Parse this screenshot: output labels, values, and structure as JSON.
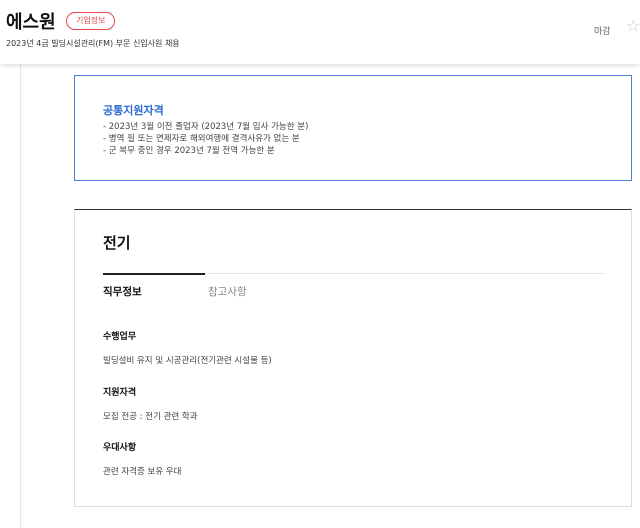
{
  "header": {
    "company": "에스원",
    "badge": "기업정보",
    "subtitle": "2023년 4급 빌딩시설관리(FM) 부문 신입사원 채용",
    "deadline": "마감",
    "star_icon": "star-outline-icon"
  },
  "qualification": {
    "title": "공통지원자격",
    "lines": [
      "- 2023년 3월 이전 졸업자 (2023년 7월 입사 가능한 분)",
      "- 병역 필 또는 면제자로 해외여행에 결격사유가 없는 분",
      "- 군 복무 중인 경우 2023년 7월 전역 가능한 분"
    ]
  },
  "job": {
    "title": "전기",
    "tabs": [
      "직무정보",
      "참고사항"
    ],
    "sections": [
      {
        "heading": "수행업무",
        "text": "빌딩설비 유지 및 시공관리(전기관련 시설물 등)"
      },
      {
        "heading": "지원자격",
        "text": "모집 전공 : 전기 관련 학과"
      },
      {
        "heading": "우대사항",
        "text": "관련 자격증 보유 우대"
      }
    ]
  }
}
